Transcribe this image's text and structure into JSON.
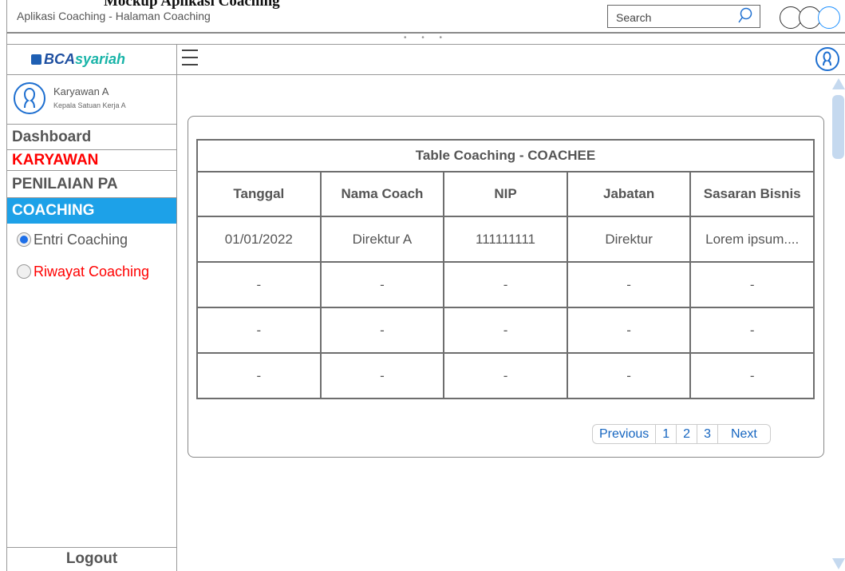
{
  "window": {
    "title": "Aplikasi Coaching -  Halaman Coaching",
    "search_placeholder": "Search",
    "handle_dots": "• • •"
  },
  "brand": {
    "part1": "BCA",
    "part2": "syariah"
  },
  "profile": {
    "name": "Karyawan A",
    "role": "Kepala Satuan Kerja A"
  },
  "sidebar": {
    "items": [
      {
        "label": "Dashboard"
      },
      {
        "label": "KARYAWAN"
      },
      {
        "label": "PENILAIAN PA"
      },
      {
        "label": "COACHING"
      }
    ],
    "subitems": [
      {
        "label": "Entri Coaching",
        "selected": true
      },
      {
        "label": "Riwayat Coaching",
        "selected": false
      }
    ],
    "logout": "Logout"
  },
  "table": {
    "caption": "Table Coaching - COACHEE",
    "columns": [
      "Tanggal",
      "Nama Coach",
      "NIP",
      "Jabatan",
      "Sasaran Bisnis"
    ],
    "rows": [
      [
        "01/01/2022",
        "Direktur A",
        "111111111",
        "Direktur",
        "Lorem ipsum...."
      ],
      [
        "-",
        "-",
        "-",
        "-",
        "-"
      ],
      [
        "-",
        "-",
        "-",
        "-",
        "-"
      ],
      [
        "-",
        "-",
        "-",
        "-",
        "-"
      ]
    ]
  },
  "pagination": {
    "previous": "Previous",
    "pages": [
      "1",
      "2",
      "3"
    ],
    "next": "Next"
  },
  "colors": {
    "accent": "#1da1e8",
    "alert_red": "#ff0000",
    "link_blue": "#1565c0",
    "brand_blue": "#1e4fa0",
    "brand_teal": "#19b4a8"
  }
}
